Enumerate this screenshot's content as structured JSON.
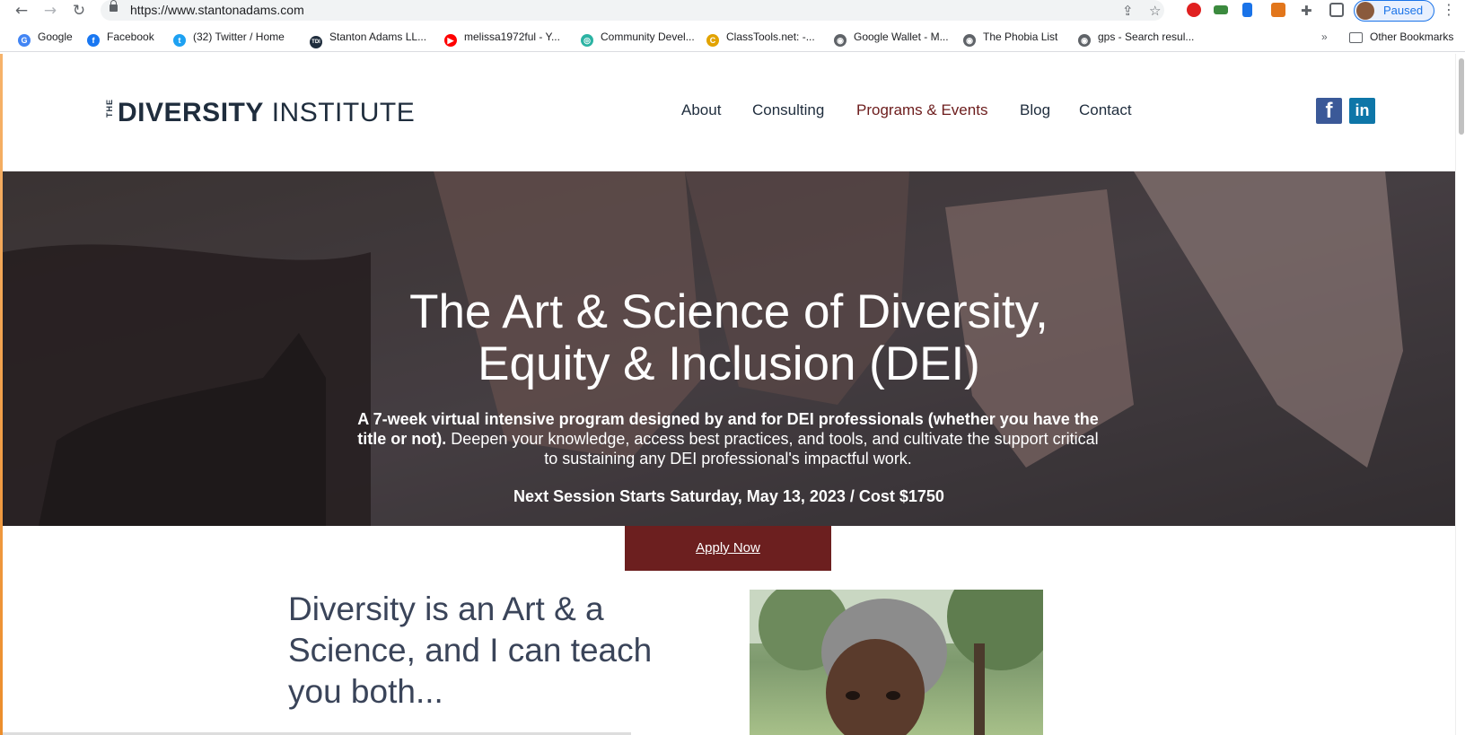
{
  "browser": {
    "url": "https://www.stantonadams.com",
    "profile_label": "Paused",
    "bookmarks": [
      {
        "label": "Google",
        "icon": "google-icon",
        "color": "#4285f4",
        "glyph": "G"
      },
      {
        "label": "Facebook",
        "icon": "facebook-icon",
        "color": "#1877f2",
        "glyph": "f"
      },
      {
        "label": "(32) Twitter / Home",
        "icon": "twitter-icon",
        "color": "#1da1f2",
        "glyph": "t"
      },
      {
        "label": "Stanton Adams LL...",
        "icon": "tdi-icon",
        "color": "#1f2d3d",
        "glyph": "TDI"
      },
      {
        "label": "melissa1972ful - Y...",
        "icon": "youtube-icon",
        "color": "#ff0000",
        "glyph": "▶"
      },
      {
        "label": "Community Devel...",
        "icon": "community-icon",
        "color": "#2bb3a3",
        "glyph": "◎"
      },
      {
        "label": "ClassTools.net: -...",
        "icon": "classtools-icon",
        "color": "#e2a300",
        "glyph": "C"
      },
      {
        "label": "Google Wallet - M...",
        "icon": "globe-icon",
        "color": "#5f6368",
        "glyph": "◉"
      },
      {
        "label": "The Phobia List",
        "icon": "globe-icon",
        "color": "#5f6368",
        "glyph": "◉"
      },
      {
        "label": "gps - Search resul...",
        "icon": "globe-icon",
        "color": "#5f6368",
        "glyph": "◉"
      }
    ],
    "more_bookmarks": "»",
    "other_bookmarks": "Other Bookmarks"
  },
  "site": {
    "logo": {
      "the": "THE",
      "diversity": "DIVERSITY",
      "institute": " INSTITUTE"
    },
    "nav": [
      "About",
      "Consulting",
      "Programs & Events",
      "Blog",
      "Contact"
    ],
    "active_nav": "Programs & Events",
    "social": {
      "facebook": "f",
      "linkedin": "in"
    },
    "colors": {
      "accent": "#6c1c1c",
      "navy": "#1f2d3d",
      "facebook": "#3b5998",
      "linkedin": "#0e76a8"
    }
  },
  "hero": {
    "title_line1": "The Art & Science of Diversity,",
    "title_line2": "Equity & Inclusion (DEI)",
    "desc_bold": "A 7-week virtual intensive program designed by and for DEI professionals (whether you have the title or not).",
    "desc_rest": " Deepen your knowledge, access best practices, and tools, and cultivate the support critical to sustaining any DEI professional's impactful work.",
    "next_session": "Next Session Starts Saturday, May 13, 2023 / Cost $1750"
  },
  "cta": {
    "apply_label": "Apply Now"
  },
  "intro": {
    "headline": "Diversity is an Art & a Science, and I can teach you both..."
  }
}
